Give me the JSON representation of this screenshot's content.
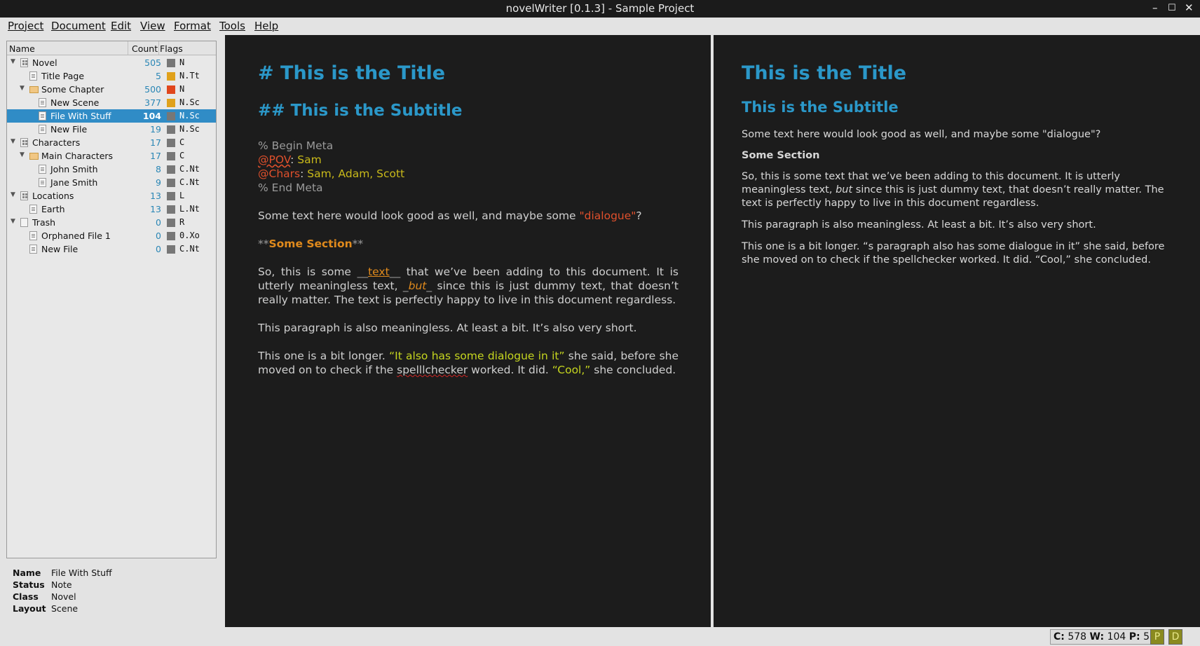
{
  "window": {
    "title": "novelWriter [0.1.3] - Sample Project"
  },
  "menu": [
    "Project",
    "Document",
    "Edit",
    "View",
    "Format",
    "Tools",
    "Help"
  ],
  "tree": {
    "columns": [
      "Name",
      "Count",
      "Flags"
    ],
    "rows": [
      {
        "label": "Novel",
        "count": "505",
        "flag": "N",
        "color": "#777777",
        "icon": "root-icon",
        "expanded": true
      },
      {
        "label": "Title Page",
        "count": "5",
        "flag": "N.Tt",
        "color": "#e0a11b",
        "icon": "document-icon"
      },
      {
        "label": "Some Chapter",
        "count": "500",
        "flag": "N",
        "color": "#e0461c",
        "icon": "folder-icon",
        "expanded": true
      },
      {
        "label": "New Scene",
        "count": "377",
        "flag": "N.Sc",
        "color": "#e0a11b",
        "icon": "document-icon"
      },
      {
        "label": "File With Stuff",
        "count": "104",
        "flag": "N.Sc",
        "color": "#777777",
        "icon": "document-icon",
        "selected": true
      },
      {
        "label": "New File",
        "count": "19",
        "flag": "N.Sc",
        "color": "#777777",
        "icon": "document-icon"
      },
      {
        "label": "Characters",
        "count": "17",
        "flag": "C",
        "color": "#777777",
        "icon": "root-icon",
        "expanded": true
      },
      {
        "label": "Main Characters",
        "count": "17",
        "flag": "C",
        "color": "#777777",
        "icon": "folder-icon",
        "expanded": true
      },
      {
        "label": "John Smith",
        "count": "8",
        "flag": "C.Nt",
        "color": "#777777",
        "icon": "document-icon"
      },
      {
        "label": "Jane Smith",
        "count": "9",
        "flag": "C.Nt",
        "color": "#777777",
        "icon": "document-icon"
      },
      {
        "label": "Locations",
        "count": "13",
        "flag": "L",
        "color": "#777777",
        "icon": "root-icon",
        "expanded": true
      },
      {
        "label": "Earth",
        "count": "13",
        "flag": "L.Nt",
        "color": "#777777",
        "icon": "document-icon"
      },
      {
        "label": "Trash",
        "count": "0",
        "flag": "R",
        "color": "#777777",
        "icon": "trash-icon",
        "expanded": true
      },
      {
        "label": "Orphaned File 1",
        "count": "0",
        "flag": "0.Xo",
        "color": "#777777",
        "icon": "document-icon"
      },
      {
        "label": "New File",
        "count": "0",
        "flag": "C.Nt",
        "color": "#777777",
        "icon": "document-icon"
      }
    ]
  },
  "details": {
    "name_key": "Name",
    "name": "File With Stuff",
    "status_key": "Status",
    "status": "Note",
    "class_key": "Class",
    "class": "Novel",
    "layout_key": "Layout",
    "layout": "Scene"
  },
  "editor": {
    "h1_mark": "#",
    "h1": "This is the Title",
    "h2_mark": "##",
    "h2": "This is the Subtitle",
    "meta_begin": "% Begin Meta",
    "pov_key": "@POV",
    "pov_val": "Sam",
    "chars_key": "@Chars",
    "chars_val": "Sam, Adam, Scott",
    "meta_end": "% End Meta",
    "p1_a": "Some text here would look good as well, and maybe some ",
    "p1_dlg": "\"dialogue\"",
    "p1_b": "?",
    "sec_mark_a": "**",
    "sec": "Some Section",
    "sec_mark_b": "**",
    "p2_a": "So, this is some ",
    "p2_u_mark_a": "__",
    "p2_u": "text",
    "p2_u_mark_b": "__",
    "p2_b": " that we’ve been adding to this document. It is utterly meaningless text, ",
    "p2_i_mark_a": "_",
    "p2_i": "but",
    "p2_i_mark_b": "_",
    "p2_c": " since this is just dummy text, that doesn’t really matter. The text is perfectly happy to live in this document regardless.",
    "p3": "This paragraph is also meaningless. At least a bit. It’s also very short.",
    "p4_a": "This one is a bit longer. ",
    "p4_dlg1": "“It also has some dialogue in it”",
    "p4_b": " she said, before she moved on to check if the ",
    "p4_spell": "spelllchecker",
    "p4_c": " worked. It did. ",
    "p4_dlg2": "“Cool,”",
    "p4_d": " she concluded."
  },
  "viewer": {
    "h1": "This is the Title",
    "h2": "This is the Subtitle",
    "p1": "Some text here would look good as well, and maybe some \"dialogue\"?",
    "sec": "Some Section",
    "p2_a": "So, this is some text that we’ve been adding to this document. It is utterly meaningless text, ",
    "p2_i": "but",
    "p2_b": " since this is just dummy text, that doesn’t really matter. The text is perfectly happy to live in this document regardless.",
    "p3": "This paragraph is also meaningless. At least a bit. It’s also very short.",
    "p4": "This one is a bit longer. “s paragraph also has some dialogue in it” she said, before she moved on to check if the spellchecker worked. It did. “Cool,” she concluded."
  },
  "statusbar": {
    "c_label": "C:",
    "c": "578",
    "w_label": "W:",
    "w": "104",
    "p_label": "P:",
    "p": "5",
    "badge_p": "P",
    "badge_d": "D"
  }
}
